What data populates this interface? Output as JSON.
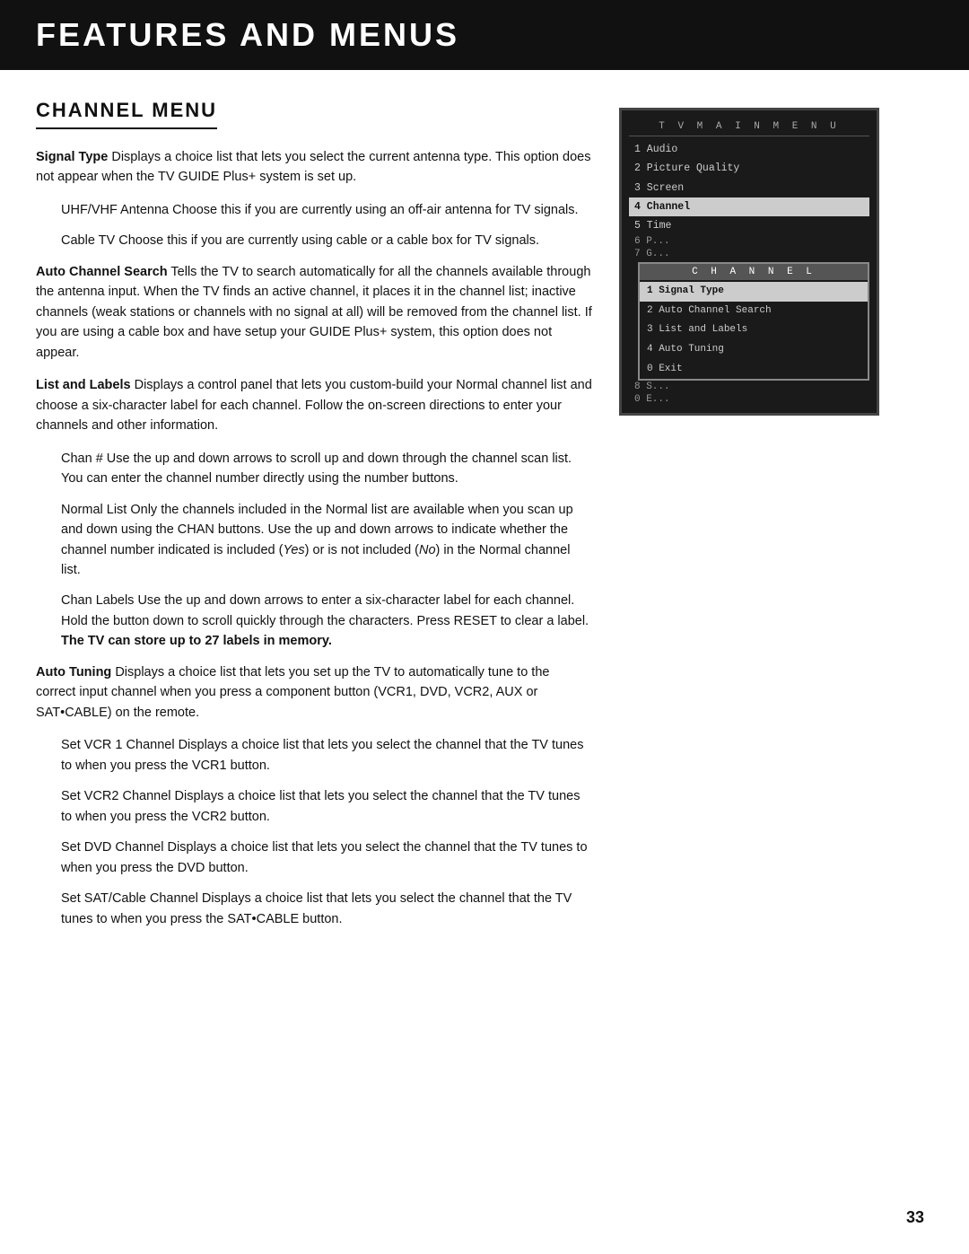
{
  "header": {
    "title": "FEATURES AND MENUS"
  },
  "section": {
    "title": "CHANNEL MENU"
  },
  "paragraphs": [
    {
      "id": "signal-type",
      "term": "Signal Type",
      "text": "  Displays a choice list that lets you select the current antenna type. This option does not appear when the TV GUIDE Plus+ system is set up."
    },
    {
      "id": "uhf-vhf",
      "term": "UHF/VHF Antenna",
      "text": "  Choose this if you are currently using an off-air antenna for TV signals.",
      "indent": true
    },
    {
      "id": "cable-tv",
      "term": "Cable TV",
      "text": "  Choose this if you are currently using cable or a cable box for TV signals.",
      "indent": true
    },
    {
      "id": "auto-channel",
      "term": "Auto Channel Search",
      "text": "  Tells the TV to search automatically for all the channels available through the antenna input. When the TV finds an active channel, it places it in the channel list; inactive channels (weak stations or channels with no signal at all) will be removed from the channel list. If you are using a cable box and have setup your GUIDE Plus+ system, this option does not appear."
    },
    {
      "id": "list-labels",
      "term": "List and Labels",
      "text": "  Displays a control panel that lets you custom-build your Normal channel list and choose a six-character label for each channel. Follow the on-screen directions to enter your channels and other information."
    },
    {
      "id": "chan-hash",
      "term": "Chan #",
      "text": "  Use the up and down arrows to scroll up and down through the channel scan list. You can enter the channel number directly using the number buttons.",
      "indent": true
    },
    {
      "id": "normal-list",
      "term": "Normal List",
      "text": "  Only the channels included in the Normal list are available when you scan up and down using the CHAN buttons. Use the up and down arrows to indicate whether the channel number indicated is included (Yes) or is not included (No) in the Normal channel list.",
      "indent": true
    },
    {
      "id": "chan-labels",
      "term": "Chan Labels",
      "text": "  Use the up and down arrows to enter a six-character label for each channel. Hold the button down to scroll quickly through the characters. Press RESET to clear a label.",
      "indent": true,
      "bold_suffix": "The TV can store up to 27 labels in memory."
    },
    {
      "id": "auto-tuning",
      "term": "Auto Tuning",
      "text": "  Displays a choice list that lets you set up the TV to automatically tune to the correct input channel when you press a component button (VCR1, DVD, VCR2, AUX or SAT•CABLE) on the remote."
    },
    {
      "id": "set-vcr1",
      "term": "Set VCR 1 Channel",
      "text": "  Displays a choice list that lets you select the channel that the TV tunes to when you press the VCR1 button.",
      "indent": true
    },
    {
      "id": "set-vcr2",
      "term": "Set VCR2 Channel",
      "text": "  Displays a choice list that lets you select the channel that the TV tunes to when you press the VCR2 button.",
      "indent": true
    },
    {
      "id": "set-dvd",
      "term": "Set DVD Channel",
      "text": "  Displays a choice list that lets you select the channel that the TV tunes to when you press the DVD button.",
      "indent": true
    },
    {
      "id": "set-sat",
      "term": "Set SAT/Cable Channel",
      "text": "  Displays a choice list that lets you select the channel that the TV tunes to when you press the SAT•CABLE button.",
      "indent": true
    }
  ],
  "tv_menu": {
    "main_title": "T V   M A I N   M E N U",
    "items": [
      {
        "num": "1",
        "label": "Audio",
        "highlighted": false
      },
      {
        "num": "2",
        "label": "Picture Quality",
        "highlighted": false
      },
      {
        "num": "3",
        "label": "Screen",
        "highlighted": false
      },
      {
        "num": "4",
        "label": "Channel",
        "highlighted": true
      },
      {
        "num": "5",
        "label": "Time",
        "highlighted": false
      },
      {
        "num": "6",
        "label": "P...",
        "partial": true,
        "highlighted": false
      },
      {
        "num": "7",
        "label": "G...",
        "partial": true,
        "highlighted": false
      },
      {
        "num": "8",
        "label": "S...",
        "partial": true,
        "highlighted": false
      },
      {
        "num": "0",
        "label": "E...",
        "partial": true,
        "highlighted": false
      }
    ],
    "channel_submenu": {
      "title": "C H A N N E L",
      "items": [
        {
          "num": "1",
          "label": "Signal Type",
          "selected": true
        },
        {
          "num": "2",
          "label": "Auto Channel Search",
          "selected": false
        },
        {
          "num": "3",
          "label": "List and Labels",
          "selected": false
        },
        {
          "num": "4",
          "label": "Auto Tuning",
          "selected": false
        },
        {
          "num": "0",
          "label": "Exit",
          "selected": false
        }
      ]
    }
  },
  "page_number": "33"
}
